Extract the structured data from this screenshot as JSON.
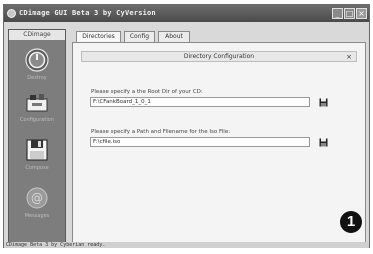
{
  "window": {
    "title": "CDimage GUI Beta 3 by CyVersion",
    "buttons": {
      "minimize": "_",
      "maximize": "□",
      "close": "×"
    }
  },
  "sidebar": {
    "header": "CDimage",
    "items": [
      {
        "label": "Destroy",
        "icon": "power-icon"
      },
      {
        "label": "Configuration",
        "icon": "toolbox-icon"
      },
      {
        "label": "Compose",
        "icon": "floppy-icon"
      },
      {
        "label": "Messages",
        "icon": "at-sign-icon"
      }
    ]
  },
  "tabs": [
    {
      "label": "Directories",
      "active": true
    },
    {
      "label": "Config",
      "active": false
    },
    {
      "label": "About",
      "active": false
    }
  ],
  "panel": {
    "title": "Directory Configuration",
    "close": "×",
    "fields": [
      {
        "label": "Please specify a the Root Dir of your CD:",
        "value": "F:\\CFankBoard_1_0_1"
      },
      {
        "label": "Please specify a Path and Filename for the Iso File:",
        "value": "F:\\cfile.iso"
      }
    ]
  },
  "status": {
    "text": "CDimage Beta 3 by Cyberian ready."
  },
  "badge": {
    "text": "1"
  },
  "colors": {
    "titlebar": "#555555",
    "sidebar": "#7d7d7d",
    "panel": "#f4f4f4",
    "badge": "#111111"
  }
}
